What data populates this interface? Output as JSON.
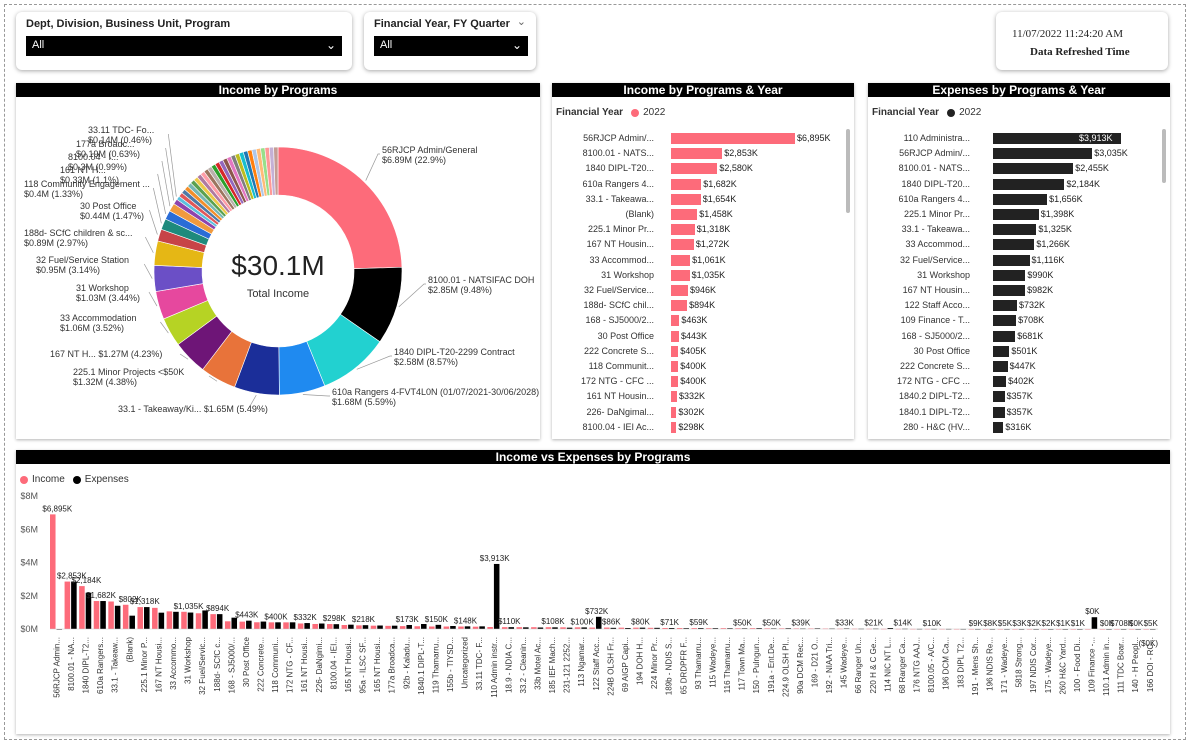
{
  "slicers": [
    {
      "title": "Dept, Division, Business Unit, Program",
      "value": "All"
    },
    {
      "title": "Financial Year, FY Quarter",
      "value": "All"
    }
  ],
  "refresh": {
    "time": "11/07/2022 11:24:20 AM",
    "label": "Data Refreshed Time"
  },
  "donut": {
    "title": "Income by Programs",
    "center_value": "$30.1M",
    "center_label": "Total Income",
    "labels": [
      {
        "text": "56RJCP Admin/General",
        "value": "$6.89M (22.9%)"
      },
      {
        "text": "8100.01 - NATSIFAC DOH",
        "value": "$2.85M (9.48%)"
      },
      {
        "text": "1840 DIPL-T20-2299 Contract",
        "value": "$2.58M (8.57%)"
      },
      {
        "text": "610a Rangers 4-FVT4L0N (01/07/2021-30/06/2028)",
        "value": "$1.68M (5.59%)"
      },
      {
        "text": "33.1 - Takeaway/Ki...",
        "value": "$1.65M (5.49%)"
      },
      {
        "text": "225.1 Minor Projects <$50K",
        "value": "$1.32M (4.38%)"
      },
      {
        "text": "167 NT H...",
        "value": "$1.27M (4.23%)"
      },
      {
        "text": "33 Accommodation",
        "value": "$1.06M (3.52%)"
      },
      {
        "text": "31 Workshop",
        "value": "$1.03M (3.44%)"
      },
      {
        "text": "32 Fuel/Service Station",
        "value": "$0.95M (3.14%)"
      },
      {
        "text": "188d- SCfC children & sc...",
        "value": "$0.89M (2.97%)"
      },
      {
        "text": "30 Post Office",
        "value": "$0.44M (1.47%)"
      },
      {
        "text": "118 Community Engagement ...",
        "value": "$0.4M (1.33%)"
      },
      {
        "text": "161 NT H...",
        "value": "$0.33M (1.1%)"
      },
      {
        "text": "8100.04 - I...",
        "value": "$0.3M (0.99%)"
      },
      {
        "text": "177a Broadc...",
        "value": "$0.19M (0.63%)"
      },
      {
        "text": "33.11 TDC- Fo...",
        "value": "$0.14M (0.46%)"
      }
    ]
  },
  "chart_data": [
    {
      "type": "pie",
      "title": "Income by Programs",
      "categories": [
        "56RJCP Admin/General",
        "8100.01 - NATSIFAC DOH",
        "1840 DIPL-T20-2299 Contract",
        "610a Rangers 4-FVT4L0N (01/07/2021-30/06/2028)",
        "33.1 - Takeaway/Ki...",
        "225.1 Minor Projects <$50K",
        "167 NT H...",
        "33 Accommodation",
        "31 Workshop",
        "32 Fuel/Service Station",
        "188d- SCfC children & sc...",
        "30 Post Office",
        "118 Community Engagement ...",
        "161 NT H...",
        "8100.04 - I...",
        "177a Broadc...",
        "33.11 TDC- Fo..."
      ],
      "values": [
        6.89,
        2.85,
        2.58,
        1.68,
        1.65,
        1.32,
        1.27,
        1.06,
        1.03,
        0.95,
        0.89,
        0.44,
        0.4,
        0.33,
        0.3,
        0.19,
        0.14
      ],
      "other_total": 4.13,
      "colors": [
        "#FD6B7A",
        "#000000",
        "#22D1D0",
        "#1F8AF0",
        "#1B2E99",
        "#E8733A",
        "#6E1577",
        "#B6D324",
        "#E6489E",
        "#6B4FC6",
        "#E5B715",
        "#C74447",
        "#1E8A7C",
        "#2A6CD6",
        "#F09A3E",
        "#8E44AD",
        "#5BC0DE"
      ]
    },
    {
      "type": "bar",
      "title": "Income by Programs & Year",
      "legend_title": "Financial Year",
      "series_name": "2022",
      "color": "#FD6B7A",
      "categories": [
        "56RJCP Admin/...",
        "8100.01 - NATS...",
        "1840 DIPL-T20...",
        "610a Rangers 4...",
        "33.1 - Takeawa...",
        "(Blank)",
        "225.1 Minor Pr...",
        "167 NT Housin...",
        "33 Accommod...",
        "31 Workshop",
        "32 Fuel/Service...",
        "188d- SCfC chil...",
        "168 - SJ5000/2...",
        "30 Post Office",
        "222 Concrete S...",
        "118 Communit...",
        "172 NTG - CFC ...",
        "161 NT Housin...",
        "226- DaNgimal...",
        "8100.04 - IEI Ac..."
      ],
      "values": [
        6895,
        2853,
        2580,
        1682,
        1654,
        1458,
        1318,
        1272,
        1061,
        1035,
        946,
        894,
        463,
        443,
        405,
        400,
        400,
        332,
        302,
        298
      ],
      "value_labels": [
        "$6,895K",
        "$2,853K",
        "$2,580K",
        "$1,682K",
        "$1,654K",
        "$1,458K",
        "$1,318K",
        "$1,272K",
        "$1,061K",
        "$1,035K",
        "$946K",
        "$894K",
        "$463K",
        "$443K",
        "$405K",
        "$400K",
        "$400K",
        "$332K",
        "$302K",
        "$298K"
      ]
    },
    {
      "type": "bar",
      "title": "Expenses by Programs & Year",
      "legend_title": "Financial Year",
      "series_name": "2022",
      "color": "#222222",
      "categories": [
        "110 Administra...",
        "56RJCP Admin/...",
        "8100.01 - NATS...",
        "1840 DIPL-T20...",
        "610a Rangers 4...",
        "225.1 Minor Pr...",
        "33.1 - Takeawa...",
        "33 Accommod...",
        "32 Fuel/Service...",
        "31 Workshop",
        "167 NT Housin...",
        "122 Staff Acco...",
        "109 Finance - T...",
        "168 - SJ5000/2...",
        "30 Post Office",
        "222 Concrete S...",
        "172 NTG - CFC ...",
        "1840.2 DIPL-T2...",
        "1840.1 DIPL-T2...",
        "280 - H&C (HV..."
      ],
      "values": [
        3913,
        3035,
        2455,
        2184,
        1656,
        1398,
        1325,
        1266,
        1116,
        990,
        982,
        732,
        708,
        681,
        501,
        447,
        402,
        357,
        357,
        316
      ],
      "value_labels": [
        "$3,913K",
        "$3,035K",
        "$2,455K",
        "$2,184K",
        "$1,656K",
        "$1,398K",
        "$1,325K",
        "$1,266K",
        "$1,116K",
        "$990K",
        "$982K",
        "$732K",
        "$708K",
        "$681K",
        "$501K",
        "$447K",
        "$402K",
        "$357K",
        "$357K",
        "$316K"
      ]
    },
    {
      "type": "bar",
      "title": "Income vs Expenses by Programs",
      "legend": [
        {
          "name": "Income",
          "color": "#FD6B7A"
        },
        {
          "name": "Expenses",
          "color": "#000000"
        }
      ],
      "yticks": [
        "$8M",
        "$6M",
        "$4M",
        "$2M",
        "$0M"
      ],
      "ylim": [
        0,
        8000
      ],
      "categories": [
        "56RJCP Admin...",
        "8100.01 - NA...",
        "1840 DIPL-T2...",
        "610a Rangers...",
        "33.1 - Takeaw...",
        "(Blank)",
        "225.1 Minor P...",
        "167 NT Housi...",
        "33 Accommo...",
        "31 Workshop",
        "32 Fuel/Servic...",
        "188d- SCfC c...",
        "168 - SJ5000/...",
        "30 Post Office",
        "222 Concrete...",
        "118 Communi...",
        "172 NTG - CF...",
        "161 NT Housi...",
        "226- DaNgimi...",
        "8100.04 - IEI...",
        "165 NT Housi...",
        "95a - ILSC SF...",
        "165 NT Housi...",
        "177a Broadca...",
        "92b - Kaladu...",
        "1840.1 DIPL-T...",
        "119 Thamarru...",
        "155b - TIYSD...",
        "Uncategorized",
        "33.11 TDC- F...",
        "110 Admin instr...",
        "18.9 - NDIA C...",
        "33.2 - Cleanin...",
        "33b Motel Ac...",
        "185 IEF Mach...",
        "231-121 2252...",
        "113 Ngamar...",
        "122 Staff Acc...",
        "224B OLSH Fr...",
        "69 AIGP Capi...",
        "194 DOH H...",
        "224 Minor Pr...",
        "189b - NDIS S...",
        "65 DRDPFR F...",
        "93 Thamarru...",
        "115 Wadeye...",
        "116 Thamarru...",
        "117 Town Ma...",
        "150 - Pulngun...",
        "191a - Ent.De...",
        "224.9 OLSH Pl...",
        "90a DCM Rec...",
        "169 - D21 O...",
        "192 - NIAA Tri...",
        "145 Wadeye...",
        "66 Ranger Un...",
        "220 H & C Ge...",
        "114 NIC NT L...",
        "68 Ranger Ca...",
        "176 NTG AAJ...",
        "8100.05 - A/C...",
        "196 DCM Ca...",
        "183 DIPL T2...",
        "191 - Mens Sh...",
        "196 NDIS Re...",
        "171 - Wadeye...",
        "5818 Strong...",
        "197 NDIS Cor...",
        "175 - Wadeye...",
        "260 H&C Yard...",
        "100 - Food Di...",
        "109 Finance -...",
        "110.1 Admin in...",
        "111 TDC Boar...",
        "140 - H Peopl...",
        "166 DOI - RC..."
      ],
      "income": [
        6895,
        2853,
        2580,
        1682,
        1654,
        1458,
        1318,
        1272,
        1061,
        1035,
        946,
        894,
        463,
        443,
        405,
        400,
        400,
        332,
        302,
        298,
        240,
        218,
        200,
        190,
        173,
        165,
        150,
        150,
        148,
        140,
        120,
        110,
        110,
        108,
        108,
        100,
        100,
        86,
        86,
        80,
        80,
        71,
        60,
        59,
        55,
        50,
        50,
        45,
        50,
        40,
        39,
        35,
        33,
        30,
        25,
        21,
        18,
        14,
        12,
        10,
        9,
        8,
        5,
        3,
        2,
        2,
        1,
        1,
        0,
        0,
        0,
        0,
        0,
        0,
        0,
        0
      ],
      "expenses": [
        0,
        2853,
        2184,
        1682,
        1398,
        802,
        1318,
        982,
        1035,
        990,
        1116,
        894,
        681,
        501,
        447,
        402,
        402,
        357,
        330,
        290,
        260,
        230,
        210,
        200,
        240,
        300,
        250,
        180,
        160,
        160,
        3913,
        110,
        100,
        90,
        100,
        80,
        95,
        732,
        70,
        60,
        80,
        70,
        60,
        50,
        55,
        50,
        45,
        40,
        50,
        35,
        45,
        30,
        40,
        30,
        35,
        20,
        25,
        60,
        20,
        10,
        9,
        8,
        5,
        3,
        2,
        2,
        1,
        1,
        0,
        0,
        0,
        708,
        0,
        0,
        0,
        0
      ],
      "value_labels": [
        {
          "i": 0,
          "label": "$6,895K"
        },
        {
          "i": 1,
          "label": "$2,853K"
        },
        {
          "i": 2,
          "label": "$2,184K"
        },
        {
          "i": 3,
          "label": "$1,682K"
        },
        {
          "i": 5,
          "label": "$802K"
        },
        {
          "i": 6,
          "label": "$1,318K"
        },
        {
          "i": 9,
          "label": "$1,035K"
        },
        {
          "i": 11,
          "label": "$894K"
        },
        {
          "i": 13,
          "label": "$443K"
        },
        {
          "i": 15,
          "label": "$400K"
        },
        {
          "i": 17,
          "label": "$332K"
        },
        {
          "i": 19,
          "label": "$298K"
        },
        {
          "i": 21,
          "label": "$218K"
        },
        {
          "i": 24,
          "label": "$173K"
        },
        {
          "i": 26,
          "label": "$150K"
        },
        {
          "i": 28,
          "label": "$148K"
        },
        {
          "i": 30,
          "label": "$3,913K"
        },
        {
          "i": 31,
          "label": "$110K"
        },
        {
          "i": 34,
          "label": "$108K"
        },
        {
          "i": 36,
          "label": "$100K"
        },
        {
          "i": 37,
          "label": "$732K"
        },
        {
          "i": 38,
          "label": "$86K"
        },
        {
          "i": 40,
          "label": "$80K"
        },
        {
          "i": 42,
          "label": "$71K"
        },
        {
          "i": 44,
          "label": "$59K"
        },
        {
          "i": 47,
          "label": "$50K"
        },
        {
          "i": 49,
          "label": "$50K"
        },
        {
          "i": 51,
          "label": "$39K"
        },
        {
          "i": 54,
          "label": "$33K"
        },
        {
          "i": 56,
          "label": "$21K"
        },
        {
          "i": 58,
          "label": "$14K"
        },
        {
          "i": 60,
          "label": "$10K"
        },
        {
          "i": 63,
          "label": "$9K"
        },
        {
          "i": 64,
          "label": "$8K"
        },
        {
          "i": 65,
          "label": "$5K"
        },
        {
          "i": 66,
          "label": "$3K"
        },
        {
          "i": 67,
          "label": "$2K"
        },
        {
          "i": 68,
          "label": "$2K"
        },
        {
          "i": 69,
          "label": "$1K"
        },
        {
          "i": 70,
          "label": "$1K"
        },
        {
          "i": 71,
          "label": "$0K"
        },
        {
          "i": 72,
          "label": "$0K"
        },
        {
          "i": 73,
          "label": "$708K"
        },
        {
          "i": 74,
          "label": "$0K"
        },
        {
          "i": 75,
          "label": "$5K"
        }
      ],
      "trailing_label": "($0K)"
    }
  ]
}
